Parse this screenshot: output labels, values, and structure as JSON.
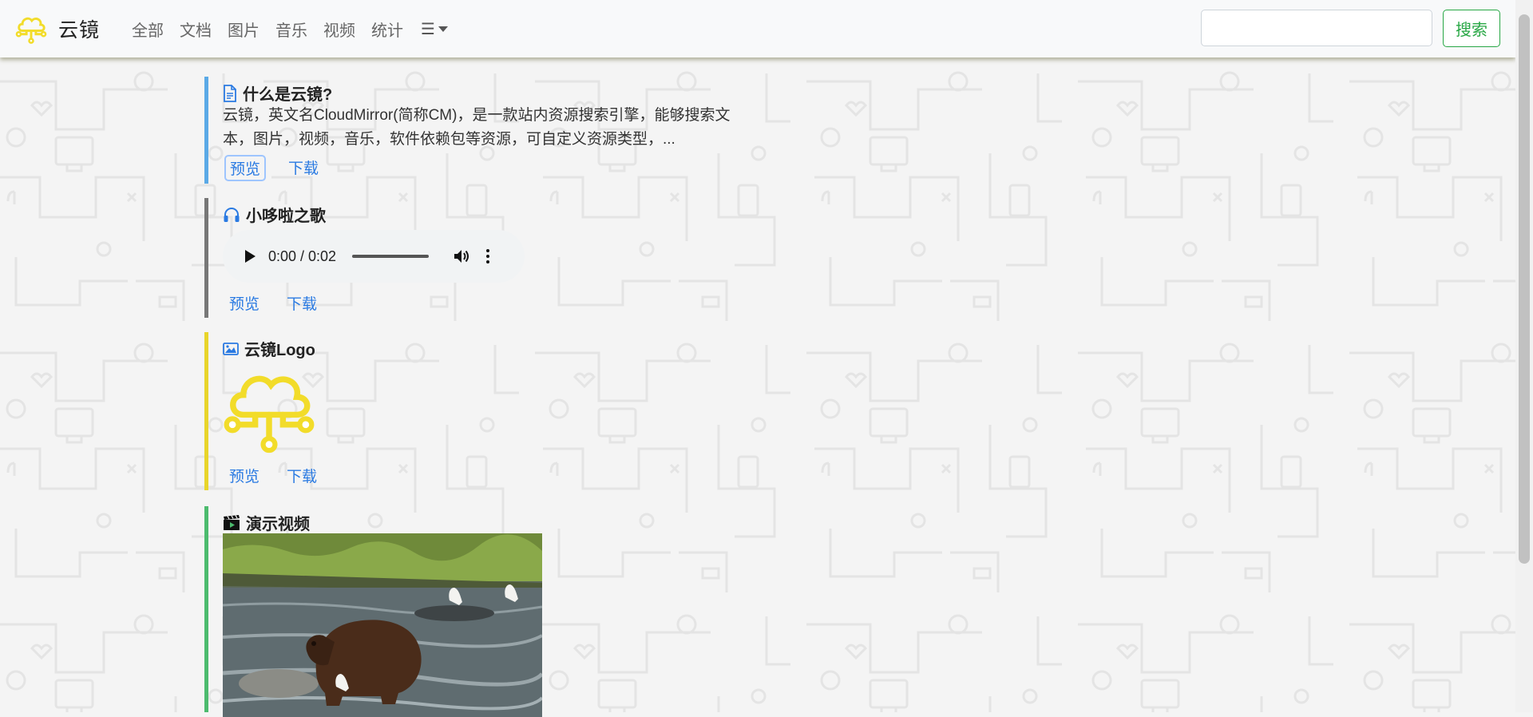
{
  "app": {
    "name": "云镜"
  },
  "nav": {
    "links": [
      "全部",
      "文档",
      "图片",
      "音乐",
      "视频",
      "统计"
    ],
    "more_label": "☰"
  },
  "search": {
    "placeholder": "",
    "button_label": "搜索"
  },
  "items": [
    {
      "type": "document",
      "title": "什么是云镜?",
      "description": "云镜，英文名CloudMirror(简称CM)，是一款站内资源搜索引擎，能够搜索文本，图片，视频，音乐，软件依赖包等资源，可自定义资源类型，...",
      "preview_label": "预览",
      "download_label": "下载",
      "accent_color": "#5aa9e6",
      "icon": "document-icon"
    },
    {
      "type": "audio",
      "title": "小哆啦之歌",
      "audio_time": "0:00 / 0:02",
      "preview_label": "预览",
      "download_label": "下载",
      "accent_color": "#777777",
      "icon": "headphones-icon"
    },
    {
      "type": "image",
      "title": "云镜Logo",
      "preview_label": "预览",
      "download_label": "下载",
      "accent_color": "#e8d52a",
      "icon": "image-icon"
    },
    {
      "type": "video",
      "title": "演示视频",
      "accent_color": "#4cbb6e",
      "icon": "film-icon"
    }
  ],
  "colors": {
    "brand_yellow": "#f2dc2a",
    "link_blue": "#2a7ae2",
    "search_green": "#28a745"
  }
}
